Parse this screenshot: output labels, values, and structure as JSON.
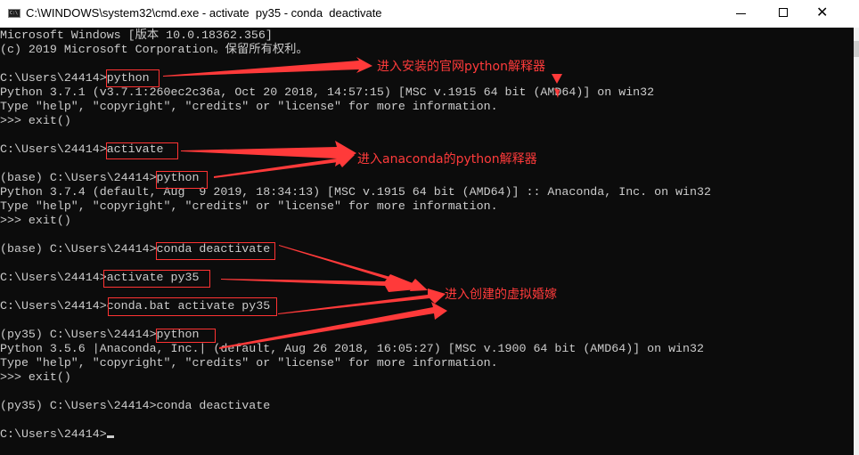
{
  "window": {
    "title": "C:\\WINDOWS\\system32\\cmd.exe - activate  py35 - conda  deactivate",
    "app_icon": "cmd-icon",
    "controls": {
      "minimize": "minimize-icon",
      "maximize": "maximize-icon",
      "close": "close-icon"
    }
  },
  "console": {
    "lines": [
      "Microsoft Windows [版本 10.0.18362.356]",
      "(c) 2019 Microsoft Corporation。保留所有权利。",
      "",
      "C:\\Users\\24414>python",
      "Python 3.7.1 (v3.7.1:260ec2c36a, Oct 20 2018, 14:57:15) [MSC v.1915 64 bit (AMD64)] on win32",
      "Type \"help\", \"copyright\", \"credits\" or \"license\" for more information.",
      ">>> exit()",
      "",
      "C:\\Users\\24414>activate",
      "",
      "(base) C:\\Users\\24414>python",
      "Python 3.7.4 (default, Aug  9 2019, 18:34:13) [MSC v.1915 64 bit (AMD64)] :: Anaconda, Inc. on win32",
      "Type \"help\", \"copyright\", \"credits\" or \"license\" for more information.",
      ">>> exit()",
      "",
      "(base) C:\\Users\\24414>conda deactivate",
      "",
      "C:\\Users\\24414>activate py35",
      "",
      "C:\\Users\\24414>conda.bat activate py35",
      "",
      "(py35) C:\\Users\\24414>python",
      "Python 3.5.6 |Anaconda, Inc.| (default, Aug 26 2018, 16:05:27) [MSC v.1900 64 bit (AMD64)] on win32",
      "Type \"help\", \"copyright\", \"credits\" or \"license\" for more information.",
      ">>> exit()",
      "",
      "(py35) C:\\Users\\24414>conda deactivate",
      "",
      "C:\\Users\\24414>"
    ]
  },
  "annotations": {
    "color": "#ff3333",
    "notes": [
      "进入安装的官网python解释器",
      "进入anaconda的python解释器",
      "进入创建的虚拟婚嫁"
    ]
  }
}
